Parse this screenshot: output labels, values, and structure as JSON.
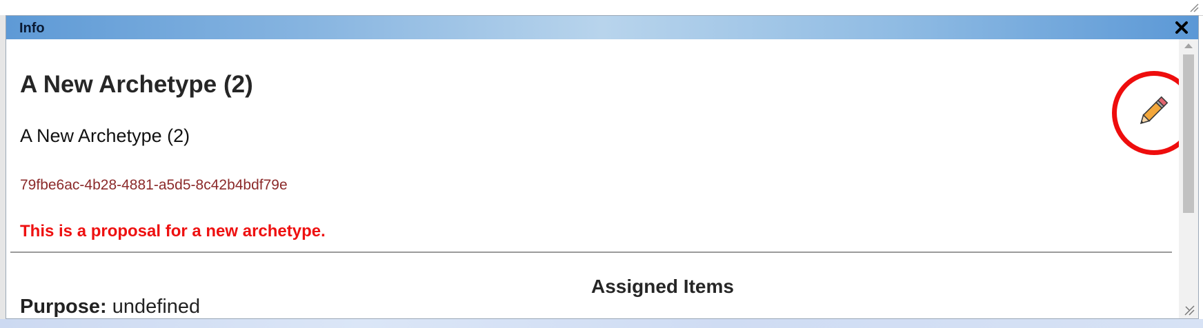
{
  "window": {
    "title": "Info"
  },
  "archetype": {
    "heading": "A New Archetype (2)",
    "name": "A New Archetype (2)",
    "uuid": "79fbe6ac-4b28-4881-a5d5-8c42b4bdf79e",
    "proposal_note": "This is a proposal for a new archetype."
  },
  "sections": {
    "assigned_items_heading": "Assigned Items",
    "purpose_label": "Purpose:",
    "purpose_value": " undefined"
  },
  "icons": {
    "close": "close-icon",
    "edit": "pencil-icon",
    "highlight": "red-circle-highlight"
  },
  "colors": {
    "titlebar_accent": "#5e9ad6",
    "proposal_text": "#ee1010",
    "uuid_text": "#8b2a2a",
    "highlight_ring": "#ee0d0d"
  }
}
